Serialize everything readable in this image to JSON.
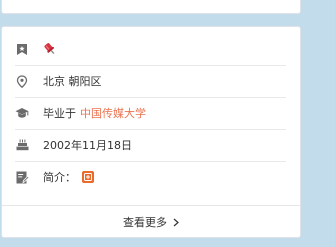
{
  "profile": {
    "medal": {
      "icon": "bookmark-star-icon",
      "badge_icon": "pushpin-badge-icon",
      "badge_color": "#d9333f"
    },
    "location": {
      "icon": "location-pin-icon",
      "text": "北京 朝阳区"
    },
    "education": {
      "icon": "graduation-cap-icon",
      "prefix": "毕业于",
      "school": "中国传媒大学",
      "link_color": "#eb7350"
    },
    "birthday": {
      "icon": "cake-icon",
      "text": "2002年11月18日"
    },
    "bio": {
      "icon": "edit-note-icon",
      "label": "简介：",
      "badge_icon": "weibo-badge-icon",
      "badge_color": "#eb6b2c"
    }
  },
  "footer": {
    "see_more": "查看更多",
    "icon": "chevron-right-icon"
  }
}
